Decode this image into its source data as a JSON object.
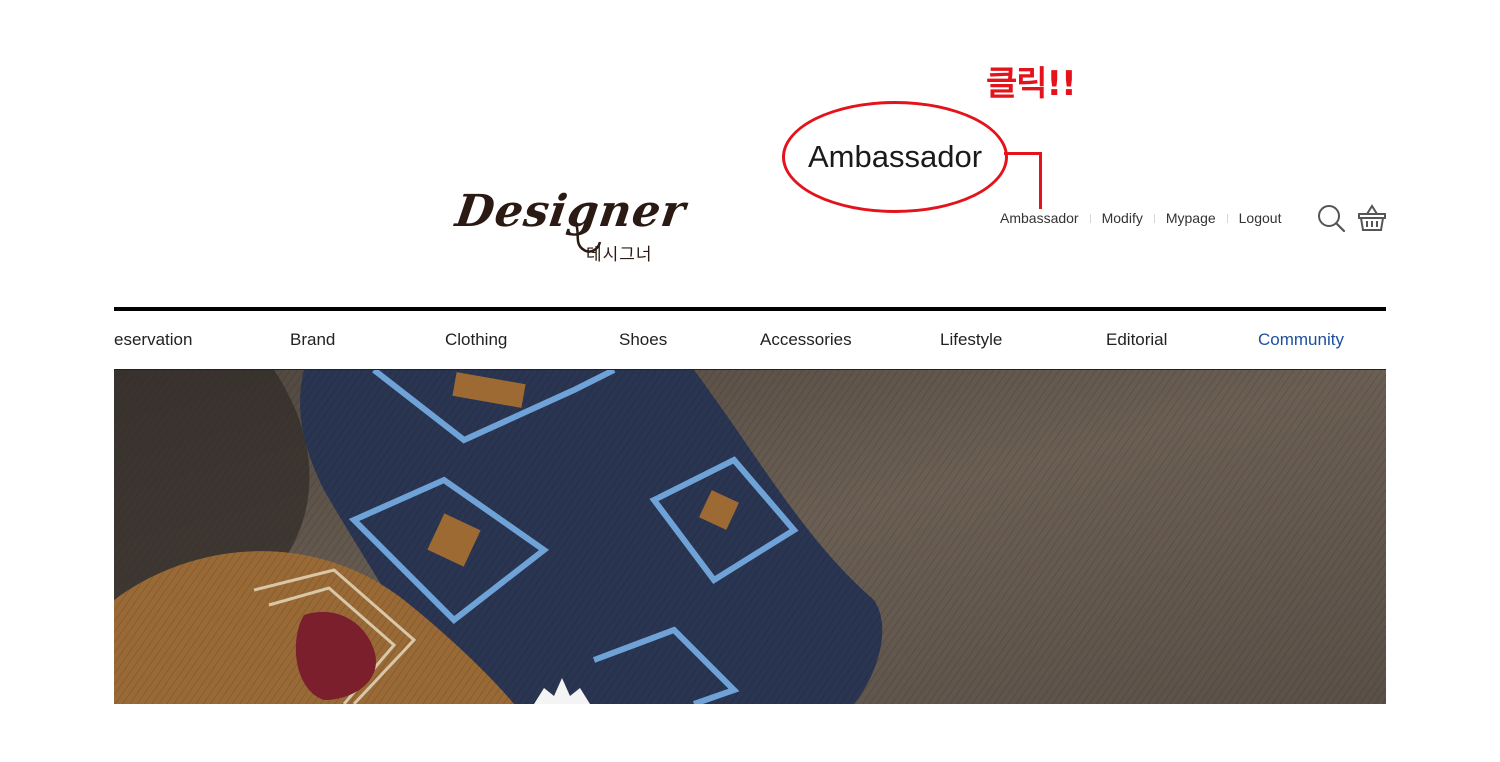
{
  "annotation": {
    "callout": "클릭!!",
    "highlight_label": "Ambassador",
    "color": "#e4131b"
  },
  "logo": {
    "script": "Designer",
    "korean": "데시그너"
  },
  "utility_links": [
    {
      "label": "Ambassador"
    },
    {
      "label": "Modify"
    },
    {
      "label": "Mypage"
    },
    {
      "label": "Logout"
    }
  ],
  "icons": {
    "search": "search-icon",
    "cart": "basket-icon"
  },
  "nav": {
    "items": [
      {
        "label": "eservation",
        "active": false
      },
      {
        "label": "Brand",
        "active": false
      },
      {
        "label": "Clothing",
        "active": false
      },
      {
        "label": "Shoes",
        "active": false
      },
      {
        "label": "Accessories",
        "active": false
      },
      {
        "label": "Lifestyle",
        "active": false
      },
      {
        "label": "Editorial",
        "active": false
      },
      {
        "label": "Community",
        "active": true
      }
    ],
    "active_color": "#1e4f9c"
  }
}
